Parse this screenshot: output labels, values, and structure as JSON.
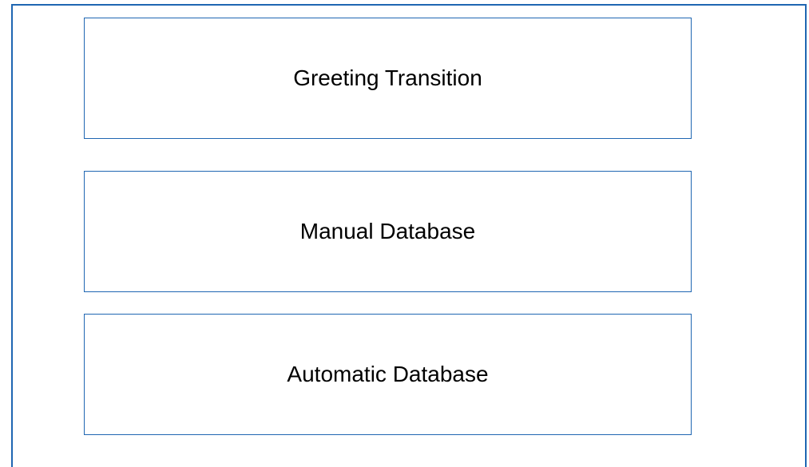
{
  "diagram": {
    "boxes": [
      {
        "label": "Greeting Transition"
      },
      {
        "label": "Manual Database"
      },
      {
        "label": "Automatic Database"
      }
    ]
  },
  "colors": {
    "border": "#1f66b2",
    "text": "#000000",
    "background": "#ffffff"
  }
}
